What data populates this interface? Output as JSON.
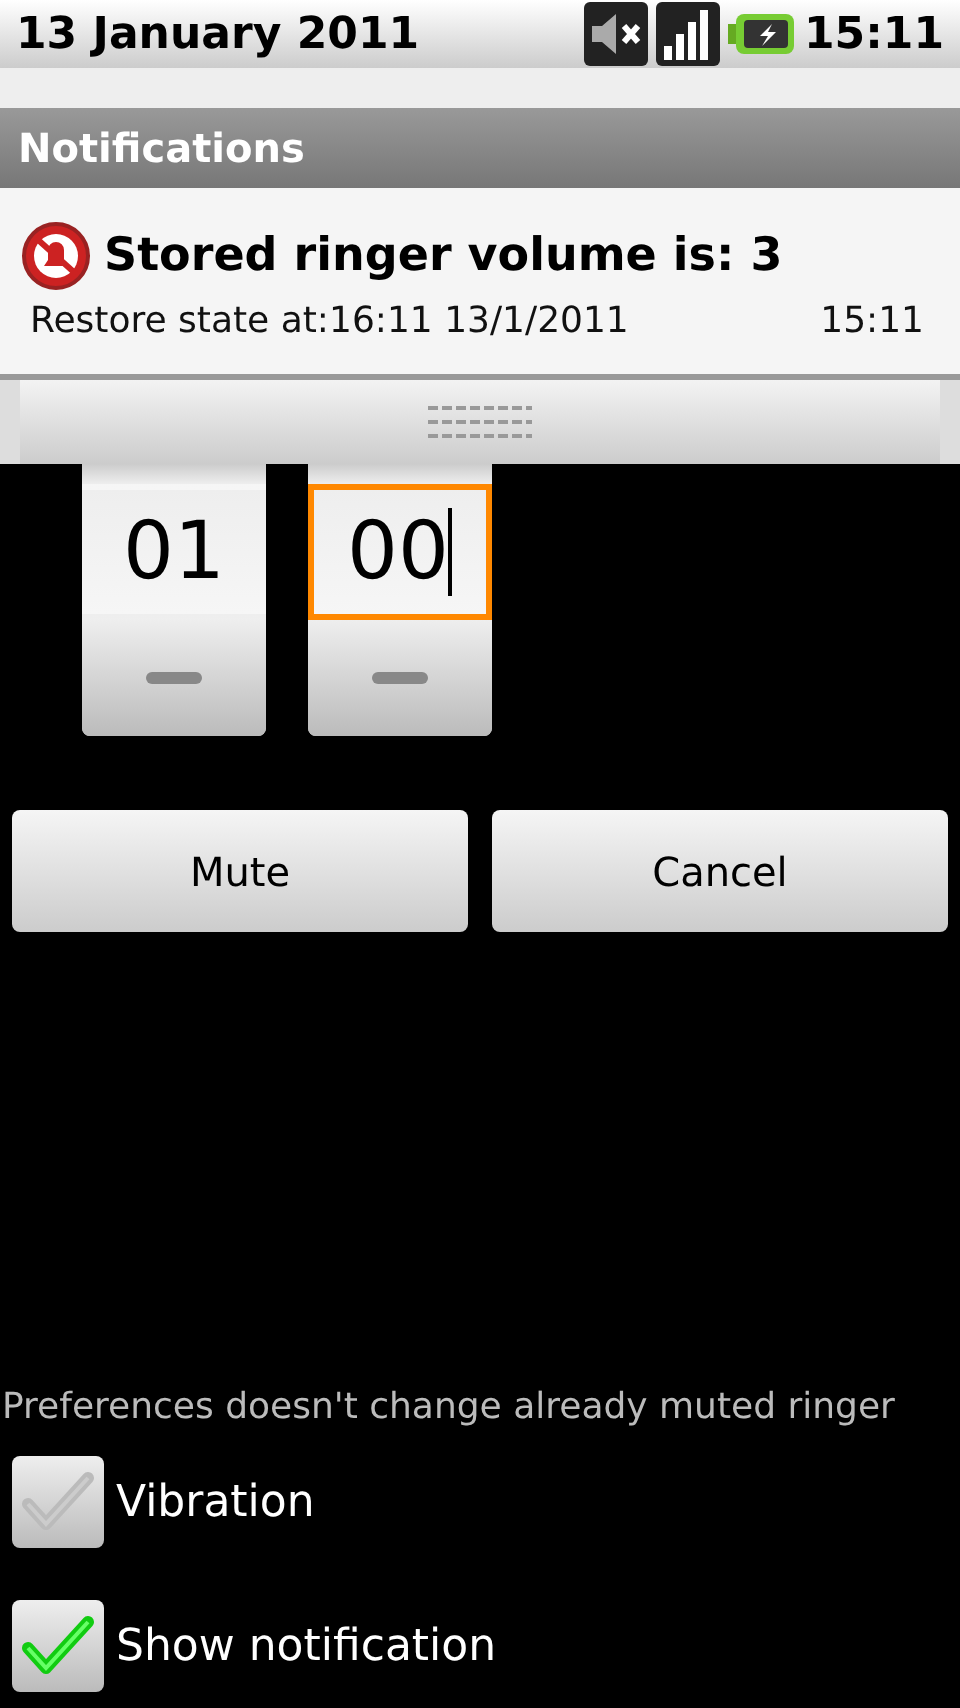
{
  "status_bar": {
    "date": "13 January 2011",
    "time": "15:11"
  },
  "notifications": {
    "title": "Notifications",
    "items": [
      {
        "title": "Stored ringer volume is: 3",
        "text": "Restore state at:16:11 13/1/2011",
        "time": "15:11"
      }
    ]
  },
  "pickers": [
    {
      "value": "01",
      "focused": false
    },
    {
      "value": "00",
      "focused": true
    }
  ],
  "buttons": [
    "Mute",
    "Cancel"
  ],
  "note": "Preferences doesn't change already muted ringer",
  "options": [
    {
      "label": "Vibration",
      "checked": false
    },
    {
      "label": "Show notification",
      "checked": true
    }
  ]
}
